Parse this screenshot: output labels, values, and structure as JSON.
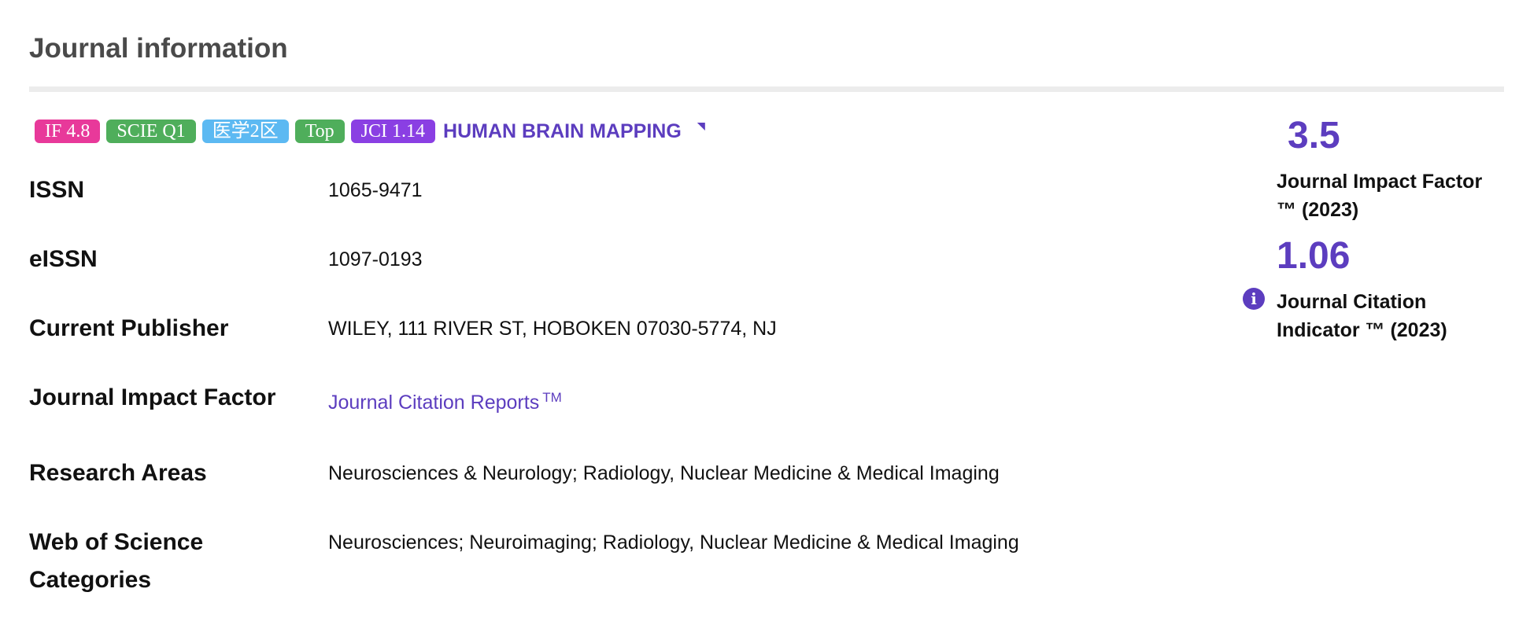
{
  "section": {
    "title": "Journal information"
  },
  "tags": {
    "if": "IF 4.8",
    "scie": "SCIE Q1",
    "cas": "医学2区",
    "top": "Top",
    "jci": "JCI 1.14"
  },
  "journal": {
    "name": "HUMAN BRAIN MAPPING"
  },
  "rows": {
    "issn": {
      "label": "ISSN",
      "value": "1065-9471"
    },
    "eissn": {
      "label": "eISSN",
      "value": "1097-0193"
    },
    "publisher": {
      "label": "Current Publisher",
      "value": "WILEY, 111 RIVER ST, HOBOKEN 07030-5774, NJ"
    },
    "jif": {
      "label": "Journal Impact Factor",
      "link_text": "Journal Citation Reports",
      "link_sup": "TM"
    },
    "areas": {
      "label": "Research Areas",
      "value": "Neurosciences & Neurology; Radiology, Nuclear Medicine & Medical Imaging"
    },
    "wos": {
      "label_line1": "Web of Science",
      "label_line2": "Categories",
      "value": "Neurosciences; Neuroimaging; Radiology, Nuclear Medicine & Medical Imaging"
    }
  },
  "metrics": {
    "jif_value": "3.5",
    "jif_label_line1": "Journal Impact Factor",
    "jif_label_line2": "™ (2023)",
    "jci_value": "1.06",
    "jci_label_line1": "Journal Citation",
    "jci_label_line2": "Indicator ™ (2023)"
  },
  "icons": {
    "info": "info-icon",
    "caret": "caret-icon"
  },
  "colors": {
    "accent": "#5c3dbf",
    "tag_if": "#e8399a",
    "tag_green": "#4fae5b",
    "tag_blue": "#5cb9f2",
    "tag_jci": "#8a3fe3"
  }
}
